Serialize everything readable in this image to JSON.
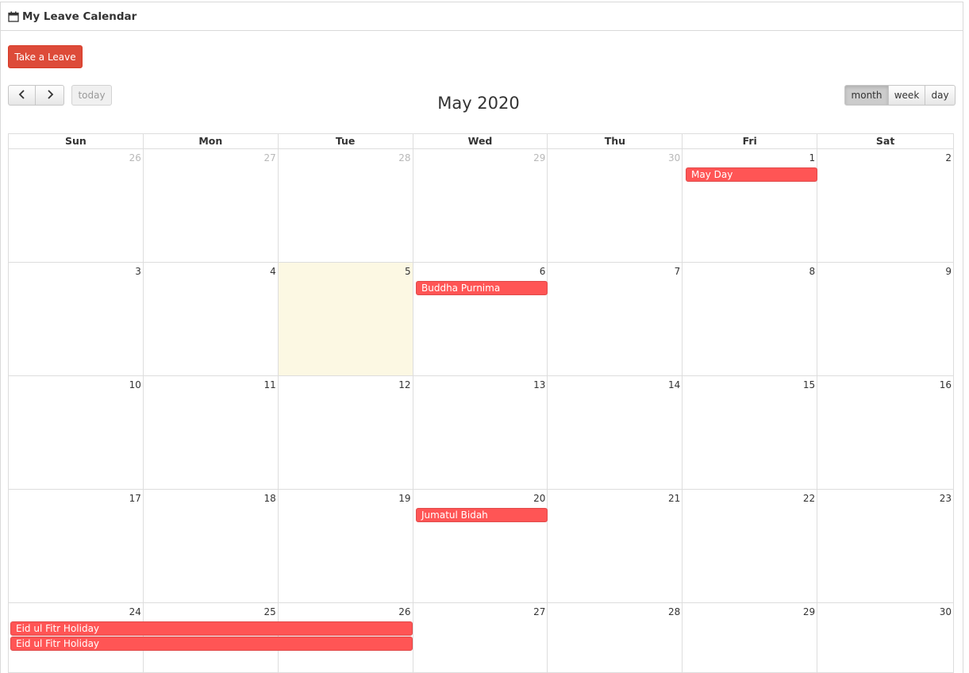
{
  "header": {
    "title": "My Leave Calendar",
    "icon": "calendar-icon"
  },
  "actions": {
    "take_leave": "Take a Leave"
  },
  "toolbar": {
    "prev_icon": "chevron-left-icon",
    "next_icon": "chevron-right-icon",
    "today": "today",
    "title": "May 2020",
    "views": [
      "month",
      "week",
      "day"
    ],
    "active_view": "month"
  },
  "calendar": {
    "weekdays": [
      "Sun",
      "Mon",
      "Tue",
      "Wed",
      "Thu",
      "Fri",
      "Sat"
    ],
    "today": "5",
    "weeks": [
      [
        "26",
        "27",
        "28",
        "29",
        "30",
        "1",
        "2"
      ],
      [
        "3",
        "4",
        "5",
        "6",
        "7",
        "8",
        "9"
      ],
      [
        "10",
        "11",
        "12",
        "13",
        "14",
        "15",
        "16"
      ],
      [
        "17",
        "18",
        "19",
        "20",
        "21",
        "22",
        "23"
      ],
      [
        "24",
        "25",
        "26",
        "27",
        "28",
        "29",
        "30"
      ]
    ],
    "other_month_days_week0": [
      "26",
      "27",
      "28",
      "29",
      "30"
    ],
    "events": [
      {
        "title": "May Day",
        "date": "2020-05-01"
      },
      {
        "title": "Buddha Purnima",
        "date": "2020-05-06"
      },
      {
        "title": "Jumatul Bidah",
        "date": "2020-05-20"
      },
      {
        "title": "Eid ul Fitr Holiday",
        "start": "2020-05-24",
        "end": "2020-05-26"
      },
      {
        "title": "Eid ul Fitr Holiday",
        "start": "2020-05-24",
        "end": "2020-05-26"
      }
    ],
    "event_color": "#ff5555",
    "today_color": "#fcf8e3"
  }
}
